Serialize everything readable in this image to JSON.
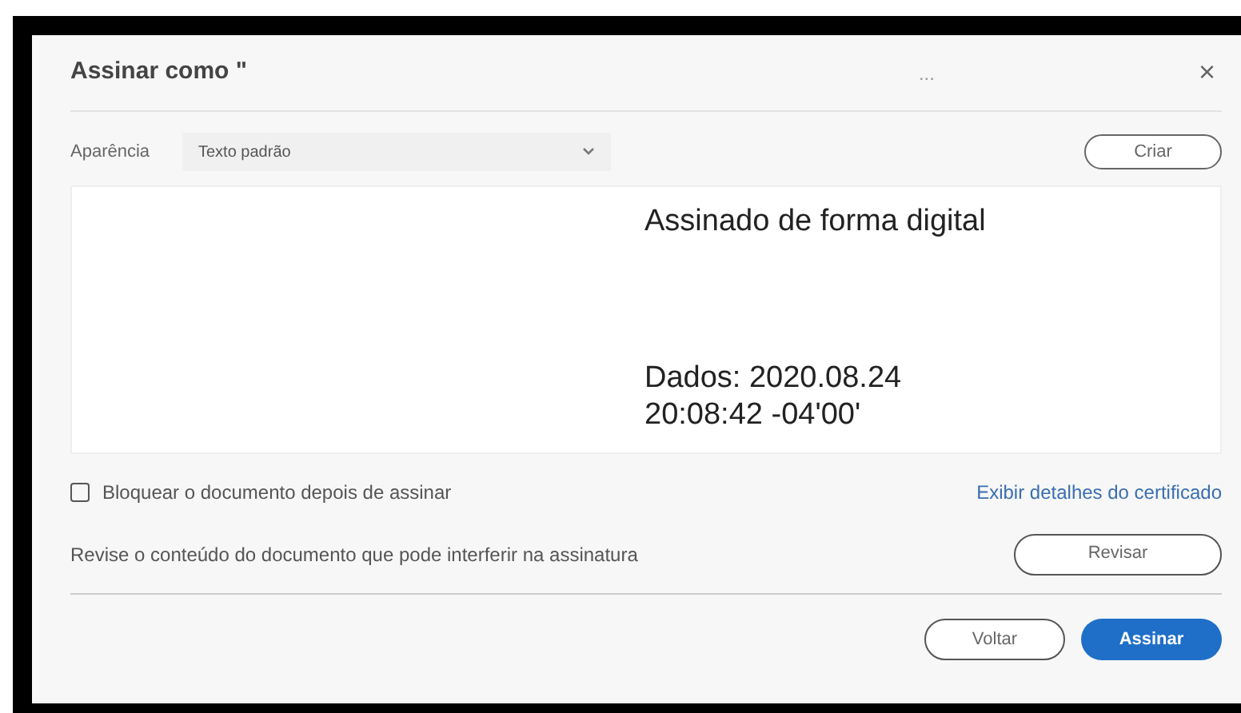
{
  "dialog": {
    "title": "Assinar como \"",
    "more": "...",
    "close": "×"
  },
  "appearance": {
    "label": "Aparência",
    "value": "Texto padrão"
  },
  "create_button": "Criar",
  "preview": {
    "lines": [
      "Assinado de forma digital",
      "Dados: 2020.08.24",
      "20:08:42 -04'00'"
    ]
  },
  "lock": {
    "label": "Bloquear o documento depois de assinar",
    "checked": false
  },
  "certificate_link": "Exibir detalhes do certificado",
  "review": {
    "text": "Revise o conteúdo do documento que pode interferir na assinatura",
    "button": "Revisar"
  },
  "buttons": [
    {
      "label": "Voltar",
      "kind": "secondary"
    },
    {
      "label": "Assinar",
      "kind": "primary"
    }
  ]
}
